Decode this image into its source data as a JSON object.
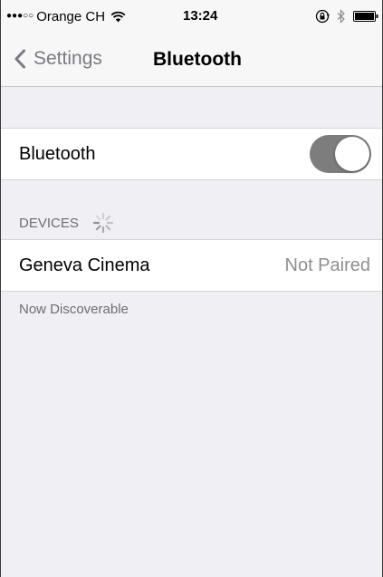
{
  "status_bar": {
    "signal": "●●●○○",
    "carrier": "Orange CH",
    "time": "13:24",
    "icons": [
      "wifi-icon",
      "rotation-lock-icon",
      "bluetooth-icon",
      "battery-icon"
    ]
  },
  "nav": {
    "back_label": "Settings",
    "title": "Bluetooth"
  },
  "bluetooth_cell": {
    "label": "Bluetooth",
    "toggle_on": true
  },
  "devices_section": {
    "header": "DEVICES",
    "items": [
      {
        "name": "Geneva Cinema",
        "status": "Not Paired"
      }
    ],
    "footer": "Now Discoverable"
  },
  "colors": {
    "toggle_on": "#7d7d7d",
    "background": "#efeff4",
    "secondary_text": "#8e8e93"
  }
}
